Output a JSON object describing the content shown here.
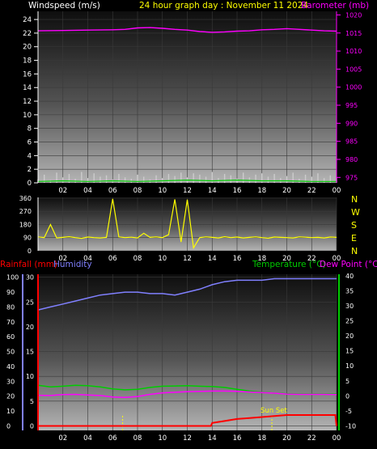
{
  "header": {
    "windspeed_label": "Windspeed (m/s)",
    "title": "24 hour graph day : November 11 2024",
    "barometer_label": "Barometer (mb)"
  },
  "x_ticks": [
    "02",
    "04",
    "06",
    "08",
    "10",
    "12",
    "14",
    "16",
    "18",
    "20",
    "22",
    "00"
  ],
  "colors": {
    "windspeed": "#ffffff",
    "title": "#ffff00",
    "barometer": "#ff00ff",
    "gust": "#cccccc",
    "wind_avg": "#00cc00",
    "direction": "#ffff00",
    "humidity": "#8080ff",
    "rainfall": "#ff0000",
    "temperature": "#00cc00",
    "dew_point": "#ff00ff",
    "sunset": "#ffff00"
  },
  "chart_data": [
    {
      "type": "line",
      "name": "wind_barometer",
      "x_ticks": [
        "02",
        "04",
        "06",
        "08",
        "10",
        "12",
        "14",
        "16",
        "18",
        "20",
        "22",
        "00"
      ],
      "left_axis": {
        "label": "Windspeed (m/s)",
        "ticks": [
          0,
          2,
          4,
          6,
          8,
          10,
          12,
          14,
          16,
          18,
          20,
          22,
          24
        ],
        "range": [
          0,
          25.2
        ]
      },
      "right_axis": {
        "label": "Barometer (mb)",
        "ticks": [
          975,
          980,
          985,
          990,
          995,
          1000,
          1005,
          1010,
          1015,
          1020
        ],
        "range": [
          973.5,
          1021
        ]
      },
      "series": [
        {
          "name": "Barometer (mb)",
          "axis": "right",
          "x": [
            0,
            2,
            4,
            6,
            7,
            8,
            9,
            10,
            11,
            12,
            13,
            14,
            15,
            16,
            17,
            18,
            19,
            20,
            21,
            22,
            23,
            24
          ],
          "values": [
            1015.6,
            1015.7,
            1015.8,
            1015.9,
            1016.0,
            1016.4,
            1016.5,
            1016.3,
            1016.0,
            1015.8,
            1015.4,
            1015.2,
            1015.3,
            1015.5,
            1015.6,
            1015.9,
            1016.0,
            1016.2,
            1016.0,
            1015.8,
            1015.6,
            1015.5
          ]
        },
        {
          "name": "Wind gust",
          "axis": "left",
          "x": [
            0,
            0.5,
            1,
            1.5,
            2,
            2.5,
            3,
            3.5,
            4,
            4.5,
            5,
            5.5,
            6,
            6.5,
            7,
            7.5,
            8,
            8.5,
            9,
            9.5,
            10,
            10.5,
            11,
            11.5,
            12,
            12.5,
            13,
            13.5,
            14,
            14.5,
            15,
            15.5,
            16,
            16.5,
            17,
            17.5,
            18,
            18.5,
            19,
            19.5,
            20,
            20.5,
            21,
            21.5,
            22,
            22.5,
            23,
            23.5,
            24
          ],
          "values": [
            0.5,
            1.2,
            0.4,
            1.5,
            0.8,
            1.3,
            0.6,
            1.6,
            0.7,
            1.4,
            0.9,
            1.1,
            0.5,
            1.3,
            0.8,
            0.6,
            1.2,
            0.9,
            0.5,
            1.1,
            0.7,
            1.3,
            1.0,
            1.5,
            0.8,
            1.4,
            1.2,
            0.9,
            1.6,
            0.7,
            1.3,
            1.1,
            0.6,
            1.5,
            0.8,
            1.2,
            1.4,
            0.9,
            1.3,
            0.7,
            1.0,
            1.5,
            0.6,
            1.2,
            0.9,
            1.4,
            0.7,
            1.1,
            0.8
          ]
        },
        {
          "name": "Wind average",
          "axis": "left",
          "x": [
            0,
            2,
            4,
            6,
            8,
            10,
            12,
            14,
            16,
            18,
            20,
            22,
            24
          ],
          "values": [
            0.2,
            0.3,
            0.2,
            0.3,
            0.2,
            0.3,
            0.4,
            0.3,
            0.4,
            0.3,
            0.3,
            0.2,
            0.2
          ]
        }
      ]
    },
    {
      "type": "scatter",
      "name": "wind_direction",
      "x_ticks": [
        "02",
        "04",
        "06",
        "08",
        "10",
        "12",
        "14",
        "16",
        "18",
        "20",
        "22",
        "00"
      ],
      "left_axis": {
        "ticks": [
          0,
          90,
          180,
          270,
          360
        ],
        "range": [
          0,
          365
        ]
      },
      "right_axis": {
        "labels": [
          "N",
          "W",
          "S",
          "E",
          "N"
        ]
      },
      "series": [
        {
          "name": "Wind direction",
          "x": [
            0,
            0.5,
            1,
            1.5,
            2,
            2.5,
            3,
            3.5,
            4,
            4.5,
            5,
            5.5,
            6,
            6.5,
            7,
            7.5,
            8,
            8.5,
            9,
            9.5,
            10,
            10.5,
            11,
            11.5,
            12,
            12.5,
            13,
            13.5,
            14,
            14.5,
            15,
            15.5,
            16,
            16.5,
            17,
            17.5,
            18,
            18.5,
            19,
            19.5,
            20,
            20.5,
            21,
            21.5,
            22,
            22.5,
            23,
            23.5,
            24
          ],
          "values": [
            95,
            90,
            180,
            88,
            92,
            96,
            90,
            85,
            94,
            90,
            88,
            92,
            355,
            95,
            90,
            93,
            88,
            120,
            92,
            95,
            90,
            110,
            352,
            60,
            350,
            20,
            90,
            95,
            92,
            88,
            96,
            90,
            94,
            88,
            92,
            95,
            90,
            86,
            94,
            92,
            90,
            88,
            95,
            93,
            90,
            92,
            88,
            94,
            92
          ]
        }
      ]
    },
    {
      "type": "line",
      "name": "rain_humidity_temperature",
      "x_ticks": [
        "02",
        "04",
        "06",
        "08",
        "10",
        "12",
        "14",
        "16",
        "18",
        "20",
        "22",
        "00"
      ],
      "axes": {
        "humidity": {
          "label": "Humidity",
          "ticks": [
            0,
            10,
            20,
            30,
            40,
            50,
            60,
            70,
            80,
            90,
            100
          ],
          "range": [
            -3,
            102
          ]
        },
        "rainfall": {
          "label": "Rainfall (mm)",
          "ticks": [
            0,
            5,
            10,
            15,
            20,
            25,
            30
          ],
          "range": [
            -0.9,
            30.6
          ]
        },
        "temperature": {
          "label": "Temperature (°C)",
          "ticks": [
            -10,
            -5,
            0,
            5,
            10,
            15,
            20,
            25,
            30,
            35,
            40
          ],
          "range": [
            -11.5,
            40.5
          ]
        }
      },
      "annotations": [
        "Sun Set"
      ],
      "sunset_x": 18.8,
      "sunrise_x": 6.8,
      "series": [
        {
          "name": "Humidity",
          "axis": "humidity",
          "x": [
            0,
            1,
            2,
            3,
            4,
            5,
            6,
            7,
            8,
            9,
            10,
            11,
            12,
            13,
            14,
            15,
            16,
            17,
            18,
            19,
            20,
            21,
            22,
            23,
            24
          ],
          "values": [
            78,
            80,
            82,
            84,
            86,
            88,
            89,
            90,
            90,
            89,
            89,
            88,
            90,
            92,
            95,
            97,
            98,
            98,
            98,
            99,
            99,
            99,
            99,
            99,
            99
          ]
        },
        {
          "name": "Rainfall (mm)",
          "axis": "rainfall",
          "x": [
            0,
            13.9,
            14,
            15,
            16,
            17,
            18,
            19,
            20,
            21,
            22,
            23,
            23.9,
            24
          ],
          "values": [
            0,
            0,
            0.6,
            1.0,
            1.4,
            1.6,
            1.8,
            2.0,
            2.2,
            2.2,
            2.2,
            2.2,
            2.2,
            0
          ]
        },
        {
          "name": "Temperature (°C)",
          "axis": "temperature",
          "x": [
            0,
            1,
            2,
            3,
            4,
            5,
            6,
            7,
            8,
            9,
            10,
            11,
            12,
            13,
            14,
            15,
            16,
            17,
            18,
            19,
            20,
            21,
            22,
            23,
            24
          ],
          "values": [
            3.5,
            3,
            3.2,
            3.5,
            3.4,
            3,
            2.3,
            2,
            2.2,
            2.8,
            3.2,
            3.3,
            3.4,
            3.2,
            3.1,
            2.8,
            2.2,
            1.6,
            1.2,
            0.9,
            0.7,
            0.6,
            0.6,
            0.6,
            0.6
          ]
        },
        {
          "name": "Dew Point (°C)",
          "axis": "temperature",
          "x": [
            0,
            1,
            2,
            3,
            4,
            5,
            6,
            7,
            8,
            9,
            10,
            11,
            12,
            13,
            14,
            15,
            16,
            17,
            18,
            19,
            20,
            21,
            22,
            23,
            24
          ],
          "values": [
            0.2,
            0.1,
            0.4,
            0.5,
            0.3,
            0.1,
            -0.4,
            -0.5,
            -0.2,
            0.5,
            1,
            1.2,
            1.4,
            1.5,
            1.6,
            1.6,
            1.5,
            1.3,
            1.1,
            0.9,
            0.6,
            0.5,
            0.5,
            0.5,
            0.4
          ]
        }
      ]
    }
  ],
  "lower_header": {
    "rainfall_label": "Rainfall (mm)",
    "humidity_label": "Humidity",
    "temperature_label": "Temperature (°C)",
    "dewpoint_label": "Dew Point (°C)",
    "sunset_label": "Sun Set"
  },
  "direction_labels": [
    "N",
    "W",
    "S",
    "E",
    "N"
  ]
}
